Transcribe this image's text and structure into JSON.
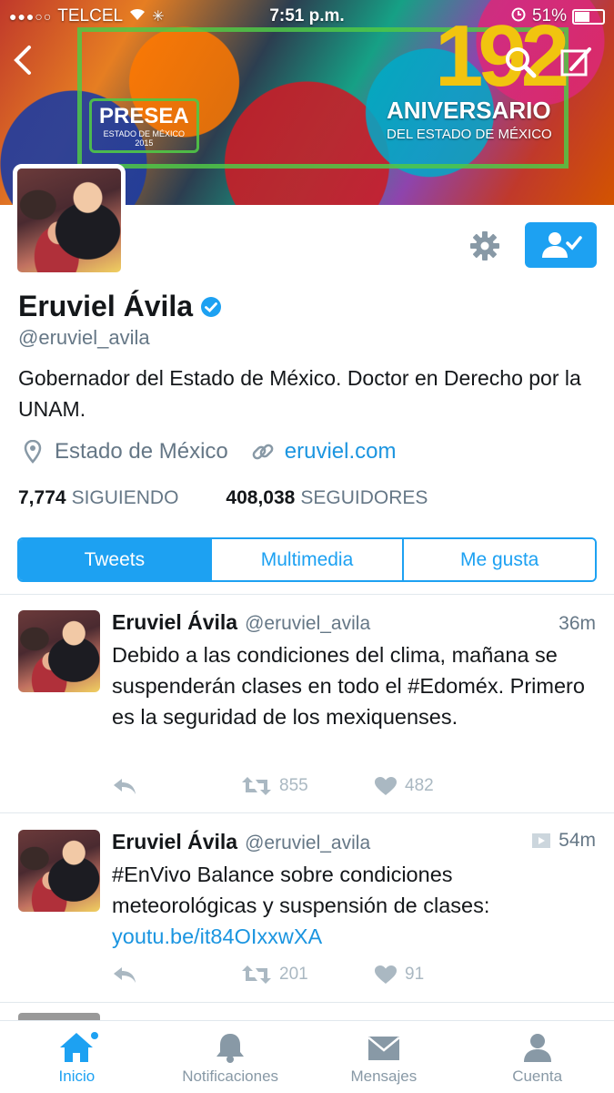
{
  "status_bar": {
    "carrier": "TELCEL",
    "signal": "●●●○○",
    "time": "7:51 p.m.",
    "battery": "51%"
  },
  "banner": {
    "presea": "PRESEA",
    "presea_sub": "ESTADO DE MÉXICO",
    "presea_year": "2015",
    "anniversary_number": "192",
    "anniversary_title": "ANIVERSARIO",
    "anniversary_subtitle": "DEL ESTADO DE MÉXICO"
  },
  "profile": {
    "name": "Eruviel Ávila",
    "handle": "@eruviel_avila",
    "bio": "Gobernador del Estado de México. Doctor en Derecho por la UNAM.",
    "location": "Estado de México",
    "website": "eruviel.com",
    "following_count": "7,774",
    "following_label": "SIGUIENDO",
    "followers_count": "408,038",
    "followers_label": "SEGUIDORES"
  },
  "tabs": [
    {
      "label": "Tweets",
      "active": true
    },
    {
      "label": "Multimedia",
      "active": false
    },
    {
      "label": "Me gusta",
      "active": false
    }
  ],
  "tweets": [
    {
      "name": "Eruviel Ávila",
      "handle": "@eruviel_avila",
      "time": "36m",
      "text": "Debido a las condiciones del clima, mañana se suspenderán clases en todo el #Edoméx. Primero es la seguridad de los mexiquenses.",
      "link": "",
      "retweets": "855",
      "likes": "482"
    },
    {
      "name": "Eruviel Ávila",
      "handle": "@eruviel_avila",
      "time": "54m",
      "text": "#EnVivo Balance sobre condiciones meteorológicas y suspensión de clases: ",
      "link": "youtu.be/it84OIxxwXA",
      "retweets": "201",
      "likes": "91"
    }
  ],
  "bottom_nav": [
    {
      "label": "Inicio",
      "icon": "home-icon",
      "active": true
    },
    {
      "label": "Notificaciones",
      "icon": "bell-icon",
      "active": false
    },
    {
      "label": "Mensajes",
      "icon": "envelope-icon",
      "active": false
    },
    {
      "label": "Cuenta",
      "icon": "person-icon",
      "active": false
    }
  ],
  "colors": {
    "accent": "#1da1f2",
    "text_secondary": "#657786",
    "icon_muted": "#aab8c2"
  }
}
